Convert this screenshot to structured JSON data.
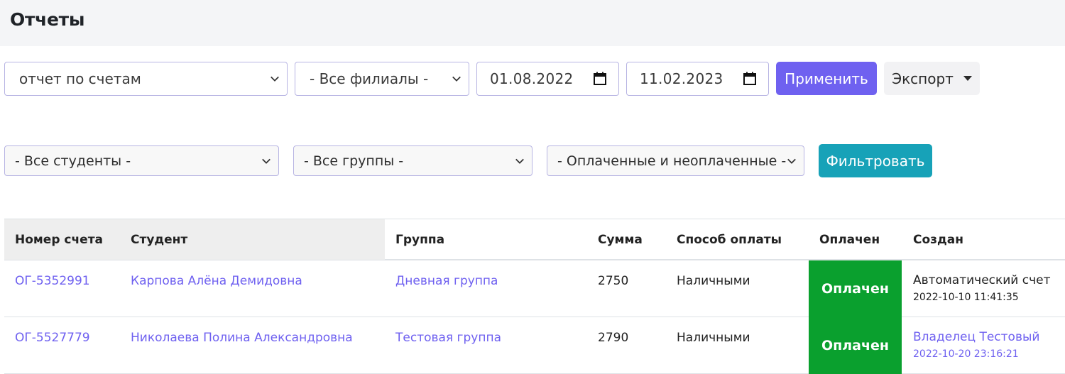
{
  "page": {
    "title": "Отчеты"
  },
  "filters_row1": {
    "report_type": "отчет по счетам",
    "branch": "- Все филиалы -",
    "date_from": "01.08.2022",
    "date_to": "11.02.2023",
    "apply_label": "Применить",
    "export_label": "Экспорт"
  },
  "filters_row2": {
    "students": "- Все студенты -",
    "groups": "- Все группы -",
    "payment_status": "- Оплаченные и неоплаченные -",
    "filter_label": "Фильтровать"
  },
  "table": {
    "columns": [
      "Номер счета",
      "Студент",
      "Группа",
      "Сумма",
      "Способ оплаты",
      "Оплачен",
      "Создан"
    ],
    "rows": [
      {
        "invoice": "ОГ-5352991",
        "student": "Карпова Алёна Демидовна",
        "group": "Дневная группа",
        "amount": "2750",
        "method": "Наличными",
        "paid": "Оплачен",
        "created_by": "Автоматический счет",
        "created_at": "2022-10-10 11:41:35"
      },
      {
        "invoice": "ОГ-5527779",
        "student": "Николаева Полина Александровна",
        "group": "Тестовая группа",
        "amount": "2790",
        "method": "Наличными",
        "paid": "Оплачен",
        "created_by": "Владелец Тестовый",
        "created_at": "2022-10-20 23:16:21"
      }
    ]
  },
  "colors": {
    "accent": "#6f61f0",
    "info": "#17a2b8",
    "paid": "#0aa02e"
  }
}
